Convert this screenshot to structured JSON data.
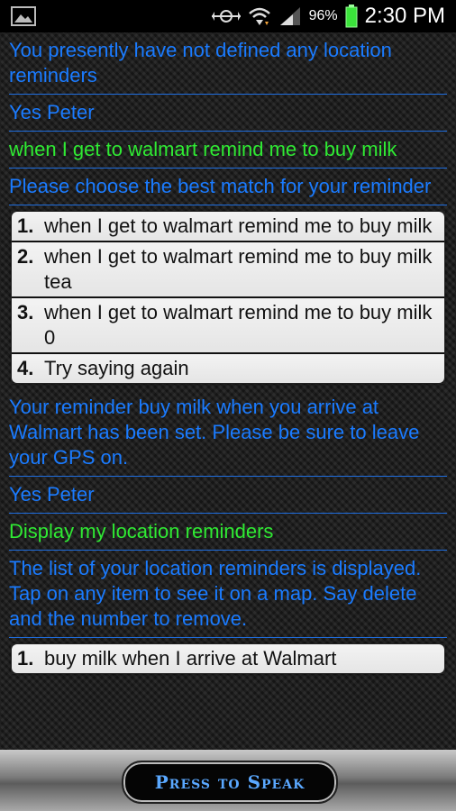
{
  "status_bar": {
    "battery_percent": "96%",
    "time": "2:30 PM",
    "icons": [
      "image-icon",
      "network-icon",
      "wifi-icon",
      "signal-icon",
      "battery-icon"
    ]
  },
  "conversation": [
    {
      "type": "text",
      "color": "blue",
      "text": "You presently have not defined any location reminders"
    },
    {
      "type": "text",
      "color": "blue",
      "text": "Yes Peter"
    },
    {
      "type": "text",
      "color": "green",
      "text": "when I get to walmart remind me to buy milk"
    },
    {
      "type": "text",
      "color": "blue",
      "text": "Please choose the best match for your reminder"
    },
    {
      "type": "choices",
      "items": [
        {
          "num": "1.",
          "text": "when I get to walmart remind me to buy milk"
        },
        {
          "num": "2.",
          "text": "when I get to walmart remind me to buy milk tea"
        },
        {
          "num": "3.",
          "text": "when I get to walmart remind me to buy milk 0"
        },
        {
          "num": "4.",
          "text": "Try saying again"
        }
      ]
    },
    {
      "type": "text",
      "color": "blue",
      "text": "Your reminder buy milk when you arrive at Walmart has been set. Please be sure to leave your GPS on."
    },
    {
      "type": "text",
      "color": "blue",
      "text": "Yes Peter"
    },
    {
      "type": "text",
      "color": "green",
      "text": "Display my location reminders"
    },
    {
      "type": "text",
      "color": "blue",
      "text": "The list of your location reminders is displayed. Tap on any item to see it on a map. Say delete and the number to remove."
    },
    {
      "type": "choices",
      "items": [
        {
          "num": "1.",
          "text": "buy milk when I arrive at Walmart"
        }
      ]
    }
  ],
  "speak_button": {
    "label": "Press to Speak"
  },
  "colors": {
    "blue": "#1a7bff",
    "green": "#2fea33",
    "divider": "#1f6ee0"
  }
}
